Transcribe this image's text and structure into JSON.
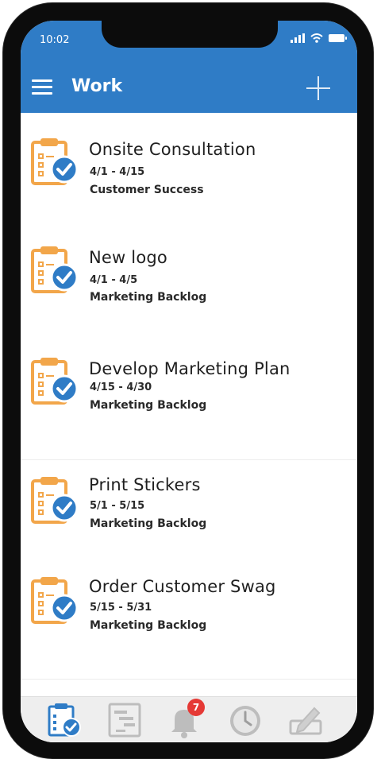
{
  "status_bar": {
    "time": "10:02"
  },
  "header": {
    "title": "Work"
  },
  "items": [
    {
      "title": "Onsite Consultation",
      "dates": "4/1 - 4/15",
      "group": "Customer Success"
    },
    {
      "title": "New logo",
      "dates": "4/1 - 4/5",
      "group": "Marketing Backlog"
    },
    {
      "title": "Develop Marketing Plan",
      "dates": "4/15 - 4/30",
      "group": "Marketing Backlog"
    },
    {
      "title": "Print Stickers",
      "dates": "5/1 - 5/15",
      "group": "Marketing Backlog"
    },
    {
      "title": "Order Customer Swag",
      "dates": "5/15 - 5/31",
      "group": "Marketing Backlog"
    }
  ],
  "tabbar": {
    "tabs": [
      {
        "icon": "clipboard-check-icon",
        "active": true
      },
      {
        "icon": "gantt-icon",
        "active": false
      },
      {
        "icon": "bell-icon",
        "active": false,
        "badge": "7"
      },
      {
        "icon": "clock-icon",
        "active": false
      },
      {
        "icon": "edit-icon",
        "active": false
      }
    ]
  },
  "colors": {
    "header": "#2f7cc6",
    "clipboard": "#f2a64a",
    "check": "#2f7cc6",
    "active_tab": "#2f7cc6",
    "inactive_tab": "#bdbdbd",
    "badge": "#e53935"
  }
}
